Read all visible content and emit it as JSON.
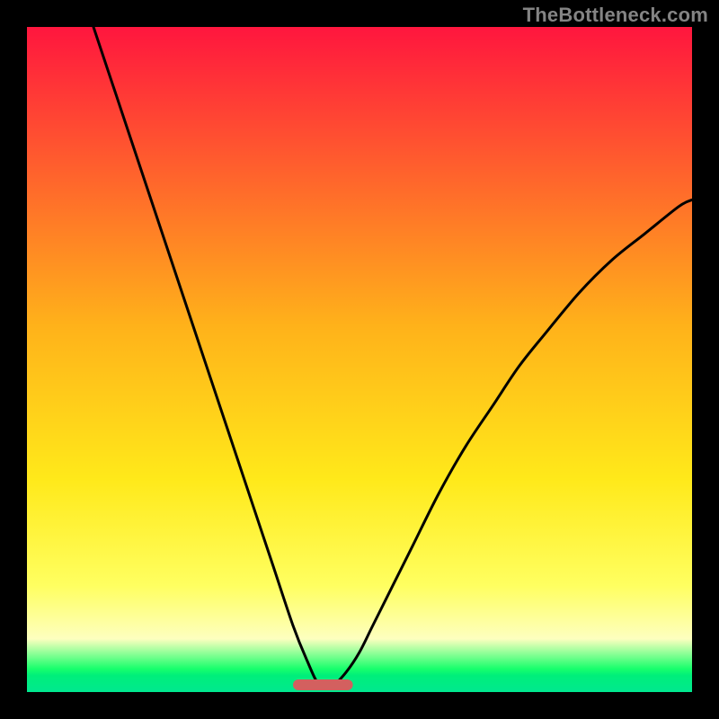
{
  "watermark": "TheBottleneck.com",
  "colors": {
    "gradient_top": "#ff163e",
    "gradient_mid": "#ffd21a",
    "gradient_yellow": "#ffff60",
    "gradient_paleyellow": "#fdffbf",
    "gradient_band_green": "#18ff6c",
    "gradient_bottom": "#00e88f",
    "curve": "#000000",
    "marker": "#d3605f",
    "frame": "#000000"
  },
  "chart_data": {
    "type": "line",
    "title": "",
    "xlabel": "",
    "ylabel": "",
    "xlim": [
      0,
      100
    ],
    "ylim": [
      0,
      100
    ],
    "marker_x_range": [
      40,
      49
    ],
    "series": [
      {
        "name": "bottleneck-curve",
        "x": [
          10,
          15,
          20,
          25,
          30,
          34,
          37,
          40,
          42,
          44,
          46,
          48,
          50,
          52,
          55,
          58,
          62,
          66,
          70,
          74,
          78,
          83,
          88,
          93,
          98,
          100
        ],
        "y": [
          100,
          85,
          70,
          55,
          40,
          28,
          19,
          10,
          5,
          1,
          1,
          3,
          6,
          10,
          16,
          22,
          30,
          37,
          43,
          49,
          54,
          60,
          65,
          69,
          73,
          74
        ]
      }
    ]
  }
}
